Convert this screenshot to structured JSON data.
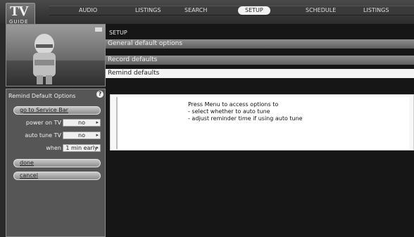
{
  "logo": {
    "main": "TV",
    "sub": "GUIDE"
  },
  "nav": {
    "tabs": [
      {
        "label": "AUDIO"
      },
      {
        "label": "LISTINGS"
      },
      {
        "label": "SEARCH"
      },
      {
        "label": "SETUP"
      },
      {
        "label": "SCHEDULE"
      },
      {
        "label": "LISTINGS"
      }
    ]
  },
  "left": {
    "panel_title": "Remind Default Options",
    "help_icon": "?",
    "go_to_service_bar": "go to Service Bar",
    "power_on_tv": {
      "label": "power on TV",
      "value": "no"
    },
    "auto_tune_tv": {
      "label": "auto tune TV",
      "value": "no"
    },
    "when": {
      "label": "when",
      "value": "1 min early"
    },
    "done": "done",
    "cancel": "cancel"
  },
  "right": {
    "breadcrumb": "SETUP",
    "sections": [
      {
        "label": "General default options",
        "style": "dark"
      },
      {
        "label": "Record defaults",
        "style": "dark"
      },
      {
        "label": "Remind defaults",
        "style": "light"
      }
    ],
    "info_lines": [
      "Press Menu to access options to",
      "- select whether to auto tune",
      "- adjust reminder time if using auto tune"
    ]
  },
  "icons": [
    "tv-guide-logo",
    "help-icon",
    "dropdown-arrow-icon",
    "mini-tv-icon"
  ]
}
